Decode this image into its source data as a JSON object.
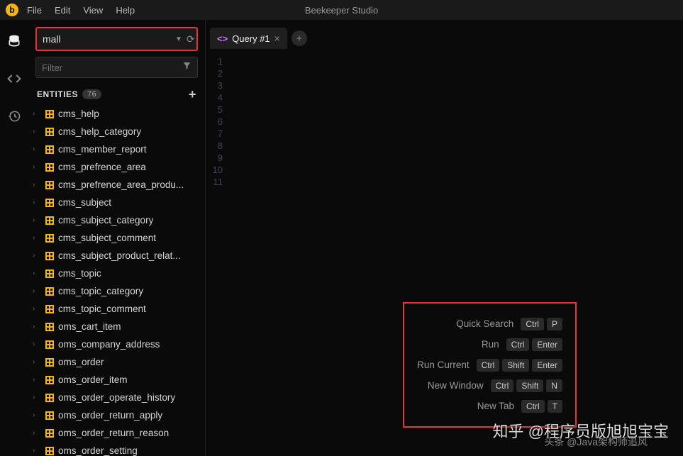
{
  "app": {
    "title": "Beekeeper Studio"
  },
  "menu": {
    "file": "File",
    "edit": "Edit",
    "view": "View",
    "help": "Help"
  },
  "connection": {
    "database": "mall",
    "filter_placeholder": "Filter"
  },
  "entities": {
    "label": "ENTITIES",
    "count": "76"
  },
  "tables": [
    "cms_help",
    "cms_help_category",
    "cms_member_report",
    "cms_prefrence_area",
    "cms_prefrence_area_produ...",
    "cms_subject",
    "cms_subject_category",
    "cms_subject_comment",
    "cms_subject_product_relat...",
    "cms_topic",
    "cms_topic_category",
    "cms_topic_comment",
    "oms_cart_item",
    "oms_company_address",
    "oms_order",
    "oms_order_item",
    "oms_order_operate_history",
    "oms_order_return_apply",
    "oms_order_return_reason",
    "oms_order_setting"
  ],
  "tabs": {
    "active": "Query #1"
  },
  "editor_lines": [
    "1",
    "2",
    "3",
    "4",
    "5",
    "6",
    "7",
    "8",
    "9",
    "10",
    "11"
  ],
  "shortcuts": [
    {
      "label": "Quick Search",
      "keys": [
        "Ctrl",
        "P"
      ]
    },
    {
      "label": "Run",
      "keys": [
        "Ctrl",
        "Enter"
      ]
    },
    {
      "label": "Run Current",
      "keys": [
        "Ctrl",
        "Shift",
        "Enter"
      ]
    },
    {
      "label": "New Window",
      "keys": [
        "Ctrl",
        "Shift",
        "N"
      ]
    },
    {
      "label": "New Tab",
      "keys": [
        "Ctrl",
        "T"
      ]
    }
  ],
  "watermark": {
    "main": "知乎 @程序员版旭旭宝宝",
    "sub": "头条 @Java架构师追风"
  }
}
